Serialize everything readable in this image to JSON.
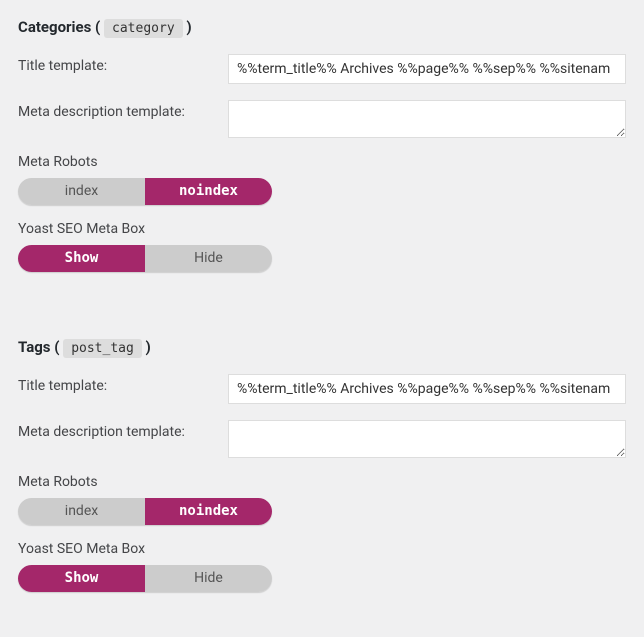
{
  "sections": [
    {
      "key": "categories",
      "heading": "Categories",
      "code": "category",
      "title_template_label": "Title template:",
      "title_template_value": "%%term_title%% Archives %%page%% %%sep%% %%sitenam",
      "meta_desc_label": "Meta description template:",
      "meta_desc_value": "",
      "robots_label": "Meta Robots",
      "robots_options": {
        "a": "index",
        "b": "noindex",
        "active": "b"
      },
      "metabox_label": "Yoast SEO Meta Box",
      "metabox_options": {
        "a": "Show",
        "b": "Hide",
        "active": "a"
      }
    },
    {
      "key": "tags",
      "heading": "Tags",
      "code": "post_tag",
      "title_template_label": "Title template:",
      "title_template_value": "%%term_title%% Archives %%page%% %%sep%% %%sitenam",
      "meta_desc_label": "Meta description template:",
      "meta_desc_value": "",
      "robots_label": "Meta Robots",
      "robots_options": {
        "a": "index",
        "b": "noindex",
        "active": "b"
      },
      "metabox_label": "Yoast SEO Meta Box",
      "metabox_options": {
        "a": "Show",
        "b": "Hide",
        "active": "a"
      }
    }
  ]
}
